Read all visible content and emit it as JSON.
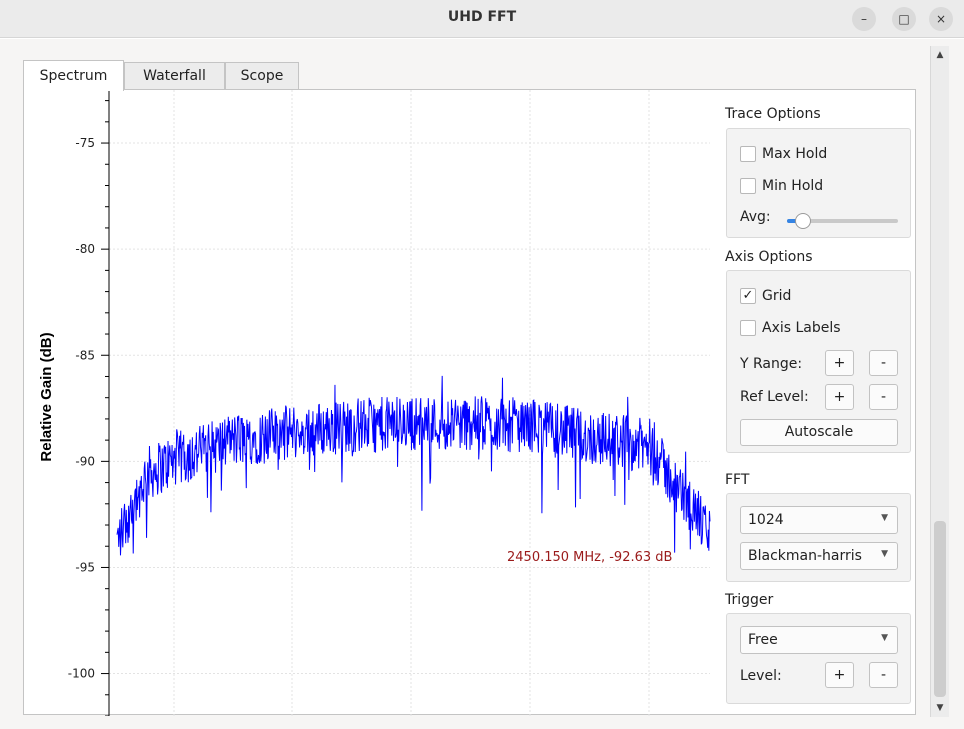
{
  "window": {
    "title": "UHD FFT",
    "minimize_glyph": "–",
    "maximize_glyph": "□",
    "close_glyph": "×"
  },
  "tabs": [
    {
      "label": "Spectrum",
      "active": true
    },
    {
      "label": "Waterfall",
      "active": false
    },
    {
      "label": "Scope",
      "active": false
    }
  ],
  "chart_data": {
    "type": "line",
    "ylabel": "Relative Gain (dB)",
    "ylim": [
      -102,
      -72.5
    ],
    "yticks": [
      -75,
      -80,
      -85,
      -90,
      -95,
      -100
    ],
    "grid": true,
    "series_color": "#0000ff",
    "marker_color": "#9a1a1a",
    "marker_label": "2450.150 MHz, -92.63 dB",
    "x_normalized": true,
    "envelope_x": [
      0.0,
      0.02,
      0.05,
      0.1,
      0.2,
      0.3,
      0.4,
      0.5,
      0.6,
      0.7,
      0.75,
      0.8,
      0.85,
      0.9,
      0.95,
      1.0
    ],
    "envelope_y": [
      -93.8,
      -92.5,
      -90.6,
      -89.9,
      -89.0,
      -88.6,
      -88.3,
      -88.2,
      -88.2,
      -88.3,
      -88.6,
      -88.9,
      -89.0,
      -89.4,
      -91.5,
      -93.4
    ],
    "noise_amplitude_db": 2.6
  },
  "sidebar": {
    "trace_options": {
      "title": "Trace Options",
      "max_hold": {
        "label": "Max Hold",
        "checked": false
      },
      "min_hold": {
        "label": "Min Hold",
        "checked": false
      },
      "avg": {
        "label": "Avg:",
        "value": 0.08
      }
    },
    "axis_options": {
      "title": "Axis Options",
      "grid": {
        "label": "Grid",
        "checked": true,
        "mark": "✓"
      },
      "axis_labels": {
        "label": "Axis Labels",
        "checked": false
      },
      "y_range": {
        "label": "Y Range:",
        "plus": "+",
        "minus": "-"
      },
      "ref_level": {
        "label": "Ref Level:",
        "plus": "+",
        "minus": "-"
      },
      "autoscale": "Autoscale"
    },
    "fft": {
      "title": "FFT",
      "size": "1024",
      "window": "Blackman-harris"
    },
    "trigger": {
      "title": "Trigger",
      "mode": "Free",
      "level": {
        "label": "Level:",
        "plus": "+",
        "minus": "-"
      }
    }
  }
}
